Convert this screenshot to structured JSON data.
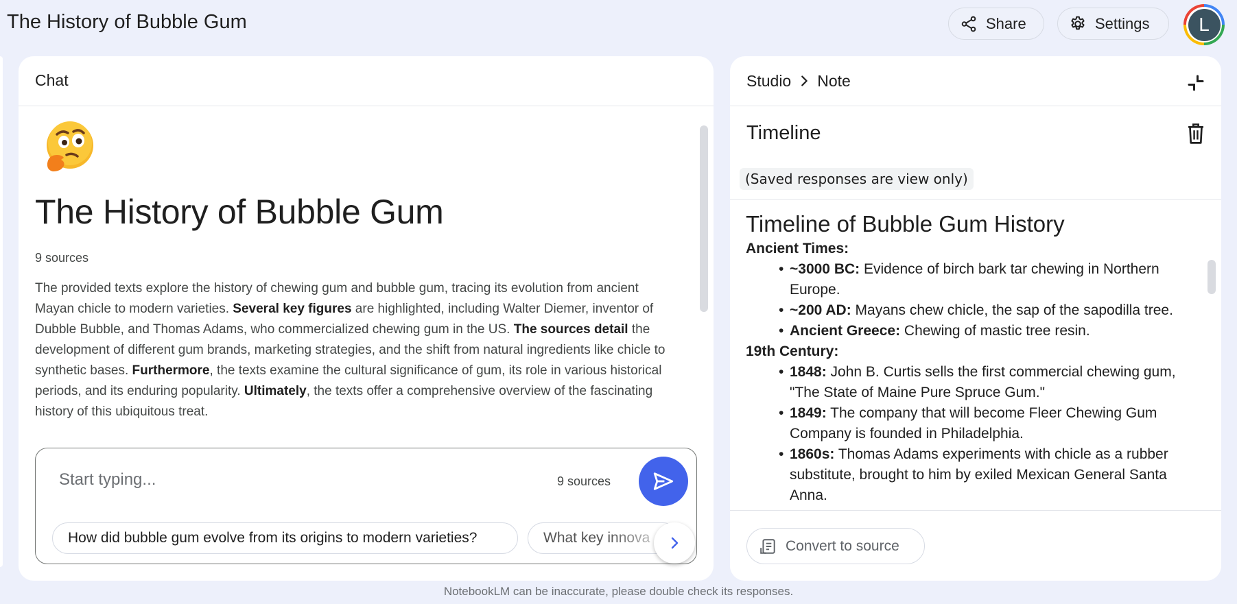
{
  "app": {
    "title": "The History of Bubble Gum"
  },
  "header": {
    "share_label": "Share",
    "settings_label": "Settings",
    "avatar_initial": "L"
  },
  "chat": {
    "header_label": "Chat",
    "notebook_emoji": "🤔",
    "notebook_title": "The History of Bubble Gum",
    "source_count": "9 sources",
    "summary_parts": [
      {
        "text": "The provided texts explore the history of chewing gum and bubble gum, tracing its evolution from ancient Mayan chicle to modern varieties. ",
        "bold": false
      },
      {
        "text": "Several key figures",
        "bold": true
      },
      {
        "text": " are highlighted, including Walter Diemer, inventor of Dubble Bubble, and Thomas Adams, who commercialized chewing gum in the US. ",
        "bold": false
      },
      {
        "text": "The sources detail",
        "bold": true
      },
      {
        "text": " the development of different gum brands, marketing strategies, and the shift from natural ingredients like chicle to synthetic bases. ",
        "bold": false
      },
      {
        "text": "Furthermore",
        "bold": true
      },
      {
        "text": ", the texts examine the cultural significance of gum, its role in various historical periods, and its enduring popularity. ",
        "bold": false
      },
      {
        "text": "Ultimately",
        "bold": true
      },
      {
        "text": ", the texts offer a comprehensive overview of the fascinating history of this ubiquitous treat.",
        "bold": false
      }
    ],
    "composer": {
      "placeholder": "Start typing...",
      "value": "",
      "sources_label": "9 sources"
    },
    "suggestions": [
      "How did bubble gum evolve from its origins to modern varieties?",
      "What key innova"
    ]
  },
  "studio": {
    "breadcrumb_root": "Studio",
    "breadcrumb_current": "Note",
    "note_title": "Timeline",
    "view_only_label": "(Saved responses are view only)",
    "note_heading": "Timeline of Bubble Gum History",
    "periods": [
      {
        "name": "Ancient Times:",
        "items": [
          {
            "key": "~3000 BC:",
            "text": " Evidence of birch bark tar chewing in Northern Europe."
          },
          {
            "key": "~200 AD:",
            "text": " Mayans chew chicle, the sap of the sapodilla tree."
          },
          {
            "key": "Ancient Greece:",
            "text": " Chewing of mastic tree resin."
          }
        ]
      },
      {
        "name": "19th Century:",
        "items": [
          {
            "key": "1848:",
            "text": " John B. Curtis sells the first commercial chewing gum, \"The State of Maine Pure Spruce Gum.\""
          },
          {
            "key": "1849:",
            "text": " The company that will become Fleer Chewing Gum Company is founded in Philadelphia."
          },
          {
            "key": "1860s:",
            "text": " Thomas Adams experiments with chicle as a rubber substitute, brought to him by exiled Mexican General Santa Anna."
          }
        ]
      }
    ],
    "convert_label": "Convert to source"
  },
  "footer": {
    "disclaimer": "NotebookLM can be inaccurate, please double check its responses."
  },
  "colors": {
    "page_bg": "#edf0fb",
    "send_button": "#4263eb",
    "panel_bg": "#ffffff"
  },
  "icons": {
    "share": "share-icon",
    "settings": "gear-icon",
    "send": "send-icon",
    "next": "chevron-right-icon",
    "breadcrumb_separator": "chevron-right-icon",
    "collapse": "collapse-icon",
    "trash": "trash-icon",
    "convert": "note-convert-icon"
  }
}
